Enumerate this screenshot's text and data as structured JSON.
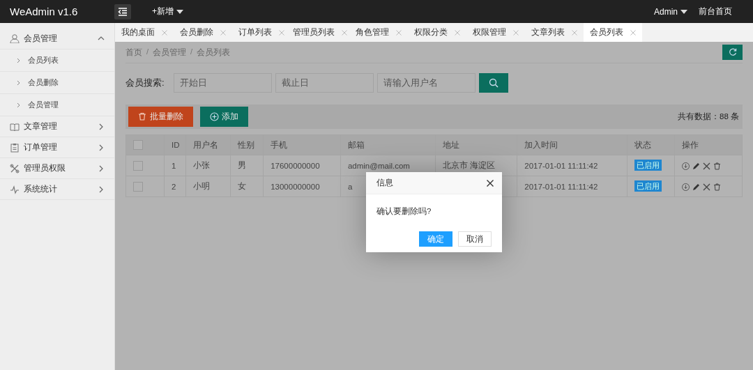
{
  "topbar": {
    "logo": "WeAdmin v1.6",
    "add_menu": "+新增",
    "user_menu": "Admin",
    "home_link": "前台首页"
  },
  "sidebar": {
    "items": [
      {
        "label": "会员管理",
        "expanded": true,
        "children": [
          {
            "label": "会员列表"
          },
          {
            "label": "会员删除"
          },
          {
            "label": "会员管理"
          }
        ]
      },
      {
        "label": "文章管理",
        "expanded": false
      },
      {
        "label": "订单管理",
        "expanded": false
      },
      {
        "label": "管理员权限",
        "expanded": false
      },
      {
        "label": "系统统计",
        "expanded": false
      }
    ]
  },
  "tabs": [
    {
      "label": "我的桌面",
      "selected": false
    },
    {
      "label": "会员删除",
      "selected": false
    },
    {
      "label": "订单列表",
      "selected": false
    },
    {
      "label": "管理员列表",
      "selected": false
    },
    {
      "label": "角色管理",
      "selected": false
    },
    {
      "label": "权限分类",
      "selected": false
    },
    {
      "label": "权限管理",
      "selected": false
    },
    {
      "label": "文章列表",
      "selected": false
    },
    {
      "label": "会员列表",
      "selected": true
    }
  ],
  "breadcrumb": {
    "separator": "/",
    "items": [
      "首页",
      "会员管理",
      "会员列表"
    ]
  },
  "search": {
    "label": "会员搜索:",
    "fields": [
      {
        "placeholder": "开始日"
      },
      {
        "placeholder": "截止日"
      },
      {
        "placeholder": "请输入用户名"
      }
    ]
  },
  "toolbar": {
    "buttons": [
      {
        "label": "批量删除",
        "kind": "danger"
      },
      {
        "label": "添加",
        "kind": "add"
      }
    ],
    "total": "共有数据：88 条"
  },
  "table": {
    "select_all_checked": false,
    "columns": [
      "ID",
      "用户名",
      "性别",
      "手机",
      "邮箱",
      "地址",
      "加入时间",
      "状态",
      "操作"
    ],
    "rows": [
      {
        "checked": false,
        "id": "1",
        "username": "小张",
        "gender": "男",
        "phone": "17600000000",
        "email": "admin@mail.com",
        "address": "北京市 海淀区",
        "joined": "2017-01-01 11:11:42",
        "status": "已启用"
      },
      {
        "checked": false,
        "id": "2",
        "username": "小明",
        "gender": "女",
        "phone": "13000000000",
        "email": "a",
        "joined": "2017-01-01 11:11:42",
        "status": "已启用"
      }
    ]
  },
  "dialog": {
    "title": "信息",
    "message": "确认要删除吗?",
    "buttons": [
      {
        "label": "确定",
        "kind": "primary"
      },
      {
        "label": "取消",
        "kind": "default"
      }
    ]
  }
}
